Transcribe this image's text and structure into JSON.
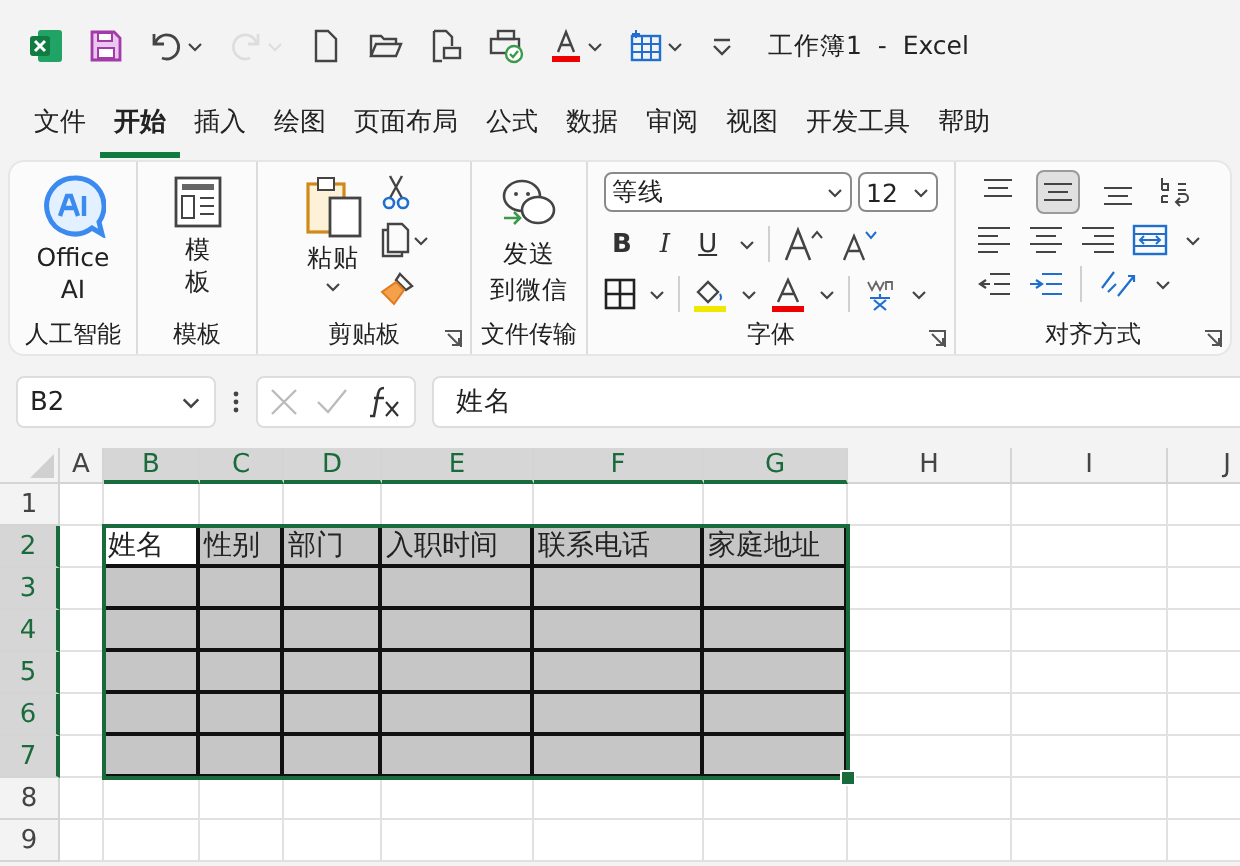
{
  "title_bar": {
    "quick_access": [
      {
        "kind": "excel",
        "disabled": false
      },
      {
        "kind": "save",
        "disabled": false
      },
      {
        "kind": "undo",
        "disabled": false
      },
      {
        "kind": "redo",
        "disabled": true
      },
      {
        "kind": "new",
        "disabled": false
      },
      {
        "kind": "open",
        "disabled": false
      },
      {
        "kind": "preview",
        "disabled": false
      },
      {
        "kind": "print",
        "disabled": false
      },
      {
        "kind": "font_color",
        "disabled": false
      },
      {
        "kind": "table",
        "disabled": false
      },
      {
        "kind": "customize",
        "disabled": false
      }
    ],
    "title": "工作簿1  -  Excel"
  },
  "tabs": [
    {
      "label": "文件",
      "selected": false
    },
    {
      "label": "开始",
      "selected": true
    },
    {
      "label": "插入",
      "selected": false
    },
    {
      "label": "绘图",
      "selected": false
    },
    {
      "label": "页面布局",
      "selected": false
    },
    {
      "label": "公式",
      "selected": false
    },
    {
      "label": "数据",
      "selected": false
    },
    {
      "label": "审阅",
      "selected": false
    },
    {
      "label": "视图",
      "selected": false
    },
    {
      "label": "开发工具",
      "selected": false
    },
    {
      "label": "帮助",
      "selected": false
    }
  ],
  "ribbon": {
    "groups": [
      {
        "kind": "ai",
        "label": "人工智能",
        "button": "Office AI",
        "launcher": false
      },
      {
        "kind": "template",
        "label": "模板",
        "button": "模板",
        "launcher": false
      },
      {
        "kind": "clipboard",
        "label": "剪贴板",
        "button": "粘贴",
        "launcher": true
      },
      {
        "kind": "transfer",
        "label": "文件传输",
        "button": [
          "发送",
          "到微信"
        ],
        "launcher": false
      },
      {
        "kind": "font",
        "label": "字体",
        "font_name": "等线",
        "font_size": "12",
        "styles": [
          "B",
          "I",
          "U"
        ],
        "launcher": true
      },
      {
        "kind": "alignment",
        "label": "对齐方式",
        "vertical": [
          {
            "kind": "top",
            "selected": false
          },
          {
            "kind": "middle",
            "selected": true
          },
          {
            "kind": "bottom",
            "selected": false
          }
        ],
        "launcher": true
      }
    ]
  },
  "formula_bar": {
    "name_box": "B2",
    "formula": "姓名"
  },
  "sheet": {
    "columns": [
      {
        "label": "A",
        "selected": false
      },
      {
        "label": "B",
        "selected": true
      },
      {
        "label": "C",
        "selected": true
      },
      {
        "label": "D",
        "selected": true
      },
      {
        "label": "E",
        "selected": true
      },
      {
        "label": "F",
        "selected": true
      },
      {
        "label": "G",
        "selected": true
      },
      {
        "label": "H",
        "selected": false
      },
      {
        "label": "I",
        "selected": false
      },
      {
        "label": "J",
        "selected": false
      }
    ],
    "rows": [
      {
        "label": "1",
        "selected": false
      },
      {
        "label": "2",
        "selected": true
      },
      {
        "label": "3",
        "selected": true
      },
      {
        "label": "4",
        "selected": true
      },
      {
        "label": "5",
        "selected": true
      },
      {
        "label": "6",
        "selected": true
      },
      {
        "label": "7",
        "selected": true
      },
      {
        "label": "8",
        "selected": false
      },
      {
        "label": "9",
        "selected": false
      }
    ],
    "table_headers": [
      {
        "text": "姓名",
        "active": true
      },
      {
        "text": "性别",
        "active": false
      },
      {
        "text": "部门",
        "active": false
      },
      {
        "text": "入职时间",
        "active": false
      },
      {
        "text": "联系电话",
        "active": false
      },
      {
        "text": "家庭地址",
        "active": false
      }
    ]
  }
}
